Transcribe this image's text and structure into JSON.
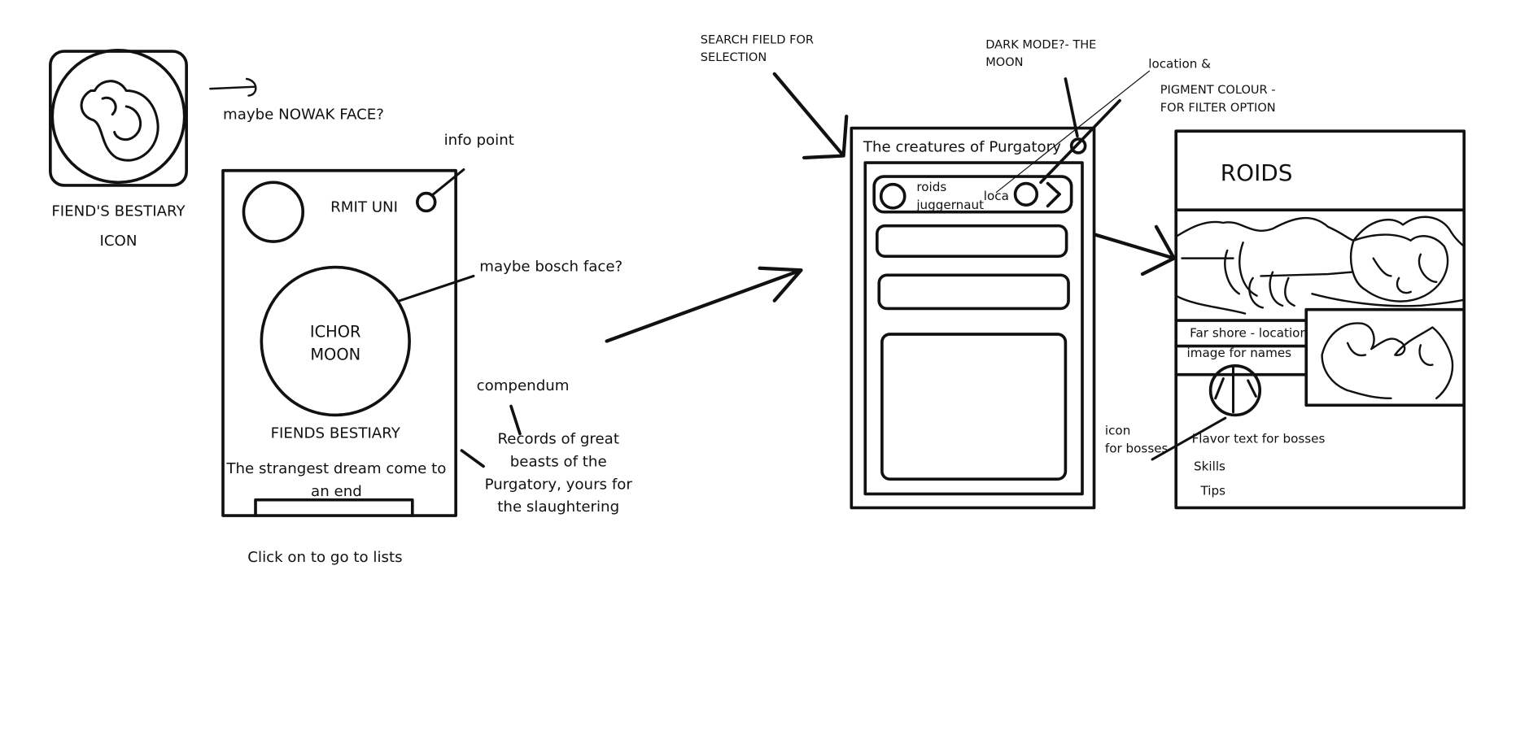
{
  "app_icon": {
    "caption_line1": "FIEND'S BESTIARY",
    "caption_line2": "ICON",
    "note": "maybe NOWAK FACE?"
  },
  "landing_screen": {
    "brand": "RMIT UNI",
    "moon_line1": "ICHOR",
    "moon_line2": "MOON",
    "title": "FIENDS BESTIARY",
    "tagline_line1": "The strangest dream come to",
    "tagline_line2": "an end",
    "notes": {
      "info_point": "info point",
      "bosch_face": "maybe bosch face?",
      "compendum": "compendum",
      "records_line1": "Records of great",
      "records_line2": "beasts of the",
      "records_line3": "Purgatory, yours for",
      "records_line4": "the slaughtering",
      "click": "Click on to go to lists"
    }
  },
  "list_screen": {
    "title": "The creatures of Purgatory",
    "first_item": {
      "name_line1": "roids",
      "name_line2": "juggernaut",
      "location": "loca"
    },
    "notes": {
      "search_line1": "SEARCH FIELD FOR",
      "search_line2": "SELECTION",
      "dark_line1": "DARK MODE?- THE",
      "dark_line2": "MOON",
      "location": "location &",
      "pigment_line1": "PIGMENT COLOUR -",
      "pigment_line2": "FOR FILTER OPTION"
    }
  },
  "detail_screen": {
    "title": "ROIDS",
    "location_label": "Far shore - location",
    "image_label": "image for names",
    "flavor": "Flavor text for bosses",
    "skills": "Skills",
    "tips": "Tips",
    "notes": {
      "icon_line1": "icon",
      "icon_line2": "for bosses"
    }
  },
  "colors": {
    "ink": "#111111",
    "background": "#ffffff"
  }
}
